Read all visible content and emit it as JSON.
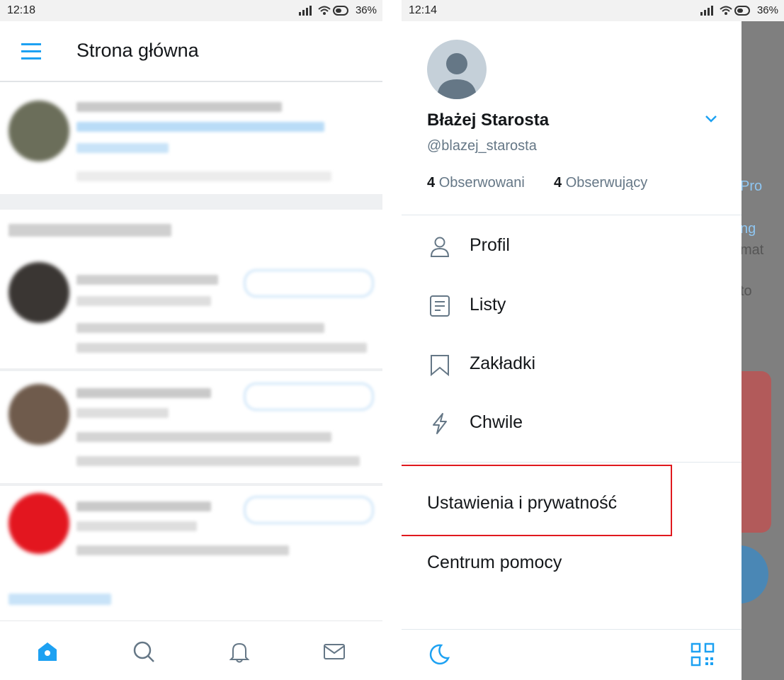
{
  "left_screen": {
    "status_bar": {
      "time": "12:18",
      "battery": "36%"
    },
    "header": {
      "title": "Strona główna"
    },
    "bottom_nav": [
      "home-icon",
      "search-icon",
      "notifications-icon",
      "messages-icon"
    ]
  },
  "right_screen": {
    "status_bar": {
      "time": "12:14",
      "battery": "36%"
    },
    "profile": {
      "name": "Błażej Starosta",
      "handle": "@blazej_starosta",
      "following_count": "4",
      "following_label": "Obserwowani",
      "followers_count": "4",
      "followers_label": "Obserwujący"
    },
    "menu": [
      {
        "label": "Profil",
        "icon": "person-icon"
      },
      {
        "label": "Listy",
        "icon": "list-icon"
      },
      {
        "label": "Zakładki",
        "icon": "bookmark-icon"
      },
      {
        "label": "Chwile",
        "icon": "lightning-icon"
      }
    ],
    "settings_label": "Ustawienia i prywatność",
    "help_label": "Centrum pomocy",
    "background_fragments": [
      "Pro",
      "ng",
      "mat",
      "to"
    ],
    "colors": {
      "accent": "#1da1f2",
      "highlight_border": "#e0191e"
    }
  }
}
